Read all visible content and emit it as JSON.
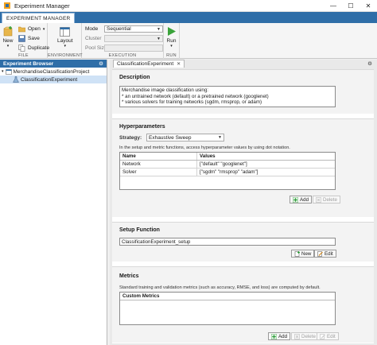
{
  "window": {
    "title": "Experiment Manager",
    "controls": {
      "minimize": "—",
      "maximize": "☐",
      "close": "✕"
    }
  },
  "ribbon": {
    "tab_label": "EXPERIMENT MANAGER",
    "file": {
      "group_label": "FILE",
      "new_label": "New",
      "open_label": "Open",
      "save_label": "Save",
      "duplicate_label": "Duplicate"
    },
    "environment": {
      "group_label": "ENVIRONMENT",
      "layout_label": "Layout"
    },
    "execution": {
      "group_label": "EXECUTION",
      "mode_label": "Mode",
      "mode_value": "Sequential",
      "cluster_label": "Cluster",
      "pool_size_label": "Pool Size"
    },
    "run": {
      "group_label": "RUN",
      "run_label": "Run"
    }
  },
  "browser": {
    "title": "Experiment Browser",
    "project": "MerchandiseClassificationProject",
    "experiment": "ClassificationExperiment"
  },
  "document": {
    "tab_label": "ClassificationExperiment",
    "description": {
      "title": "Description",
      "lines": [
        "Merchandise image classification using:",
        "* an untrained network (default) or a pretrained network (googlenet)",
        "* various solvers for training networks (sgdm, rmsprop, or adam)"
      ]
    },
    "hyperparameters": {
      "title": "Hyperparameters",
      "strategy_label": "Strategy:",
      "strategy_value": "Exhaustive Sweep",
      "hint": "In the setup and metric functions, access hyperparameter values by using dot notation.",
      "columns": [
        "Name",
        "Values"
      ],
      "rows": [
        {
          "name": "Network",
          "values": "[\"default\" \"googlenet\"]"
        },
        {
          "name": "Solver",
          "values": "[\"sgdm\" \"rmsprop\" \"adam\"]"
        }
      ],
      "add_label": "Add",
      "delete_label": "Delete"
    },
    "setup": {
      "title": "Setup Function",
      "function_name": "ClassificationExperiment_setup",
      "new_label": "New",
      "edit_label": "Edit"
    },
    "metrics": {
      "title": "Metrics",
      "hint": "Standard training and validation metrics (such as accuracy, RMSE, and loss) are computed by default.",
      "column": "Custom Metrics",
      "add_label": "Add",
      "delete_label": "Delete",
      "edit_label": "Edit"
    }
  },
  "colors": {
    "accent": "#2f6ea8",
    "selection": "#cfe2f6",
    "run_green": "#3aa33a",
    "add_green": "#2e9e3b"
  }
}
